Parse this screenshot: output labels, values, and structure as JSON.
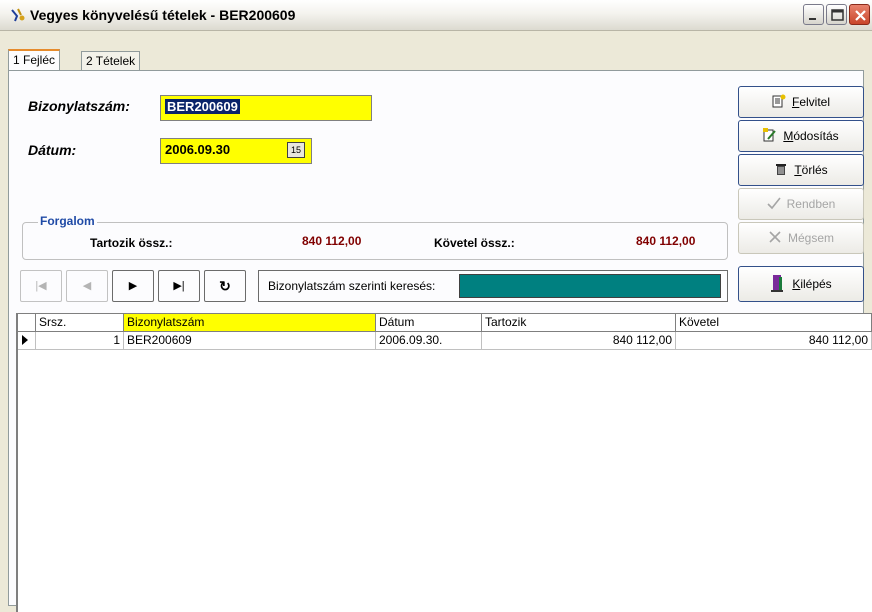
{
  "window": {
    "title": "Vegyes könyvelésű tételek - BER200609"
  },
  "tabs": [
    {
      "label": "1 Fejléc",
      "accel": "1"
    },
    {
      "label": "2 Tételek",
      "accel": "2"
    }
  ],
  "header": {
    "doc_number_label": "Bizonylatszám:",
    "doc_number_value": "BER200609",
    "date_label": "Dátum:",
    "date_value": "2006.09.30",
    "calendar_icon_text": "15"
  },
  "turnover": {
    "group_title": "Forgalom",
    "debit_label": "Tartozik össz.:",
    "debit_value": "840 112,00",
    "credit_label": "Követel össz.:",
    "credit_value": "840 112,00"
  },
  "navigator": {
    "first": "|◀",
    "prev": "◀",
    "next": "▶",
    "last": "▶|",
    "refresh": "↻"
  },
  "search": {
    "label": "Bizonylatszám szerinti keresés:",
    "value": ""
  },
  "actions": [
    {
      "label": "Felvitel",
      "accel": "F",
      "rest": "elvitel",
      "enabled": true
    },
    {
      "label": "Módosítás",
      "accel": "M",
      "rest": "ódosítás",
      "enabled": true
    },
    {
      "label": "Törlés",
      "accel": "T",
      "rest": "örlés",
      "enabled": true
    },
    {
      "label": "Rendben",
      "enabled": false
    },
    {
      "label": "Mégsem",
      "enabled": false
    },
    {
      "label": "Kilépés",
      "accel": "K",
      "rest": "ilépés",
      "enabled": true
    }
  ],
  "table": {
    "columns": [
      "Srsz.",
      "Bizonylatszám",
      "Dátum",
      "Tartozik",
      "Követel"
    ],
    "rows": [
      [
        "1",
        "BER200609",
        "2006.09.30.",
        "840 112,00",
        "840 112,00"
      ]
    ]
  },
  "colors": {
    "input_bg": "#ffff00",
    "search_bg": "#008080",
    "amount_color": "#800000",
    "group_title_color": "#1f4aa6"
  }
}
